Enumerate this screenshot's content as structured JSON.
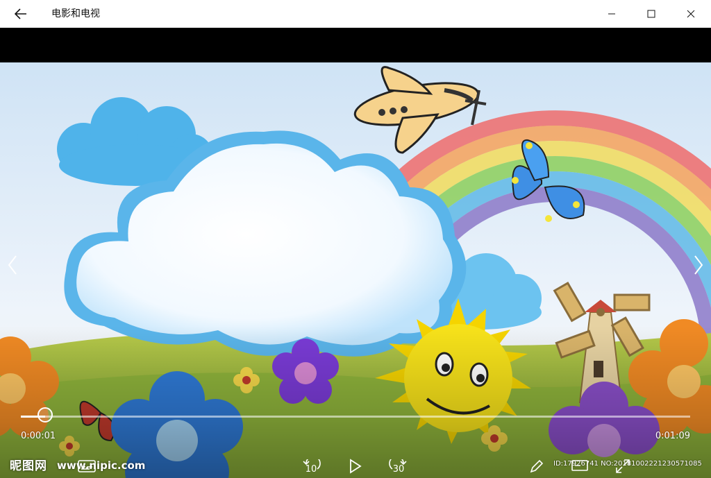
{
  "window": {
    "title": "电影和电视"
  },
  "icons": {
    "back": "back-arrow-icon",
    "minimize": "minimize-icon",
    "maximize": "maximize-icon",
    "close": "close-icon",
    "prev": "chevron-left-icon",
    "next": "chevron-right-icon",
    "rewind": "skip-back-icon",
    "play": "play-icon",
    "forward": "skip-forward-icon",
    "subtitles": "subtitles-icon",
    "edit": "pencil-icon",
    "cast": "cast-icon",
    "fullscreen": "fullscreen-icon"
  },
  "player": {
    "elapsed": "0:00:01",
    "total": "0:01:09",
    "progress": 0.036,
    "skip_back_label": "10",
    "skip_forward_label": "30"
  },
  "watermark": {
    "logo": "昵图网",
    "url": "www.nipic.com",
    "id": "ID:17926741 NO:20181002221230571085"
  },
  "colors": {
    "titlebar_bg": "#ffffff",
    "letterbox": "#000000",
    "accent": "#ffffff"
  }
}
